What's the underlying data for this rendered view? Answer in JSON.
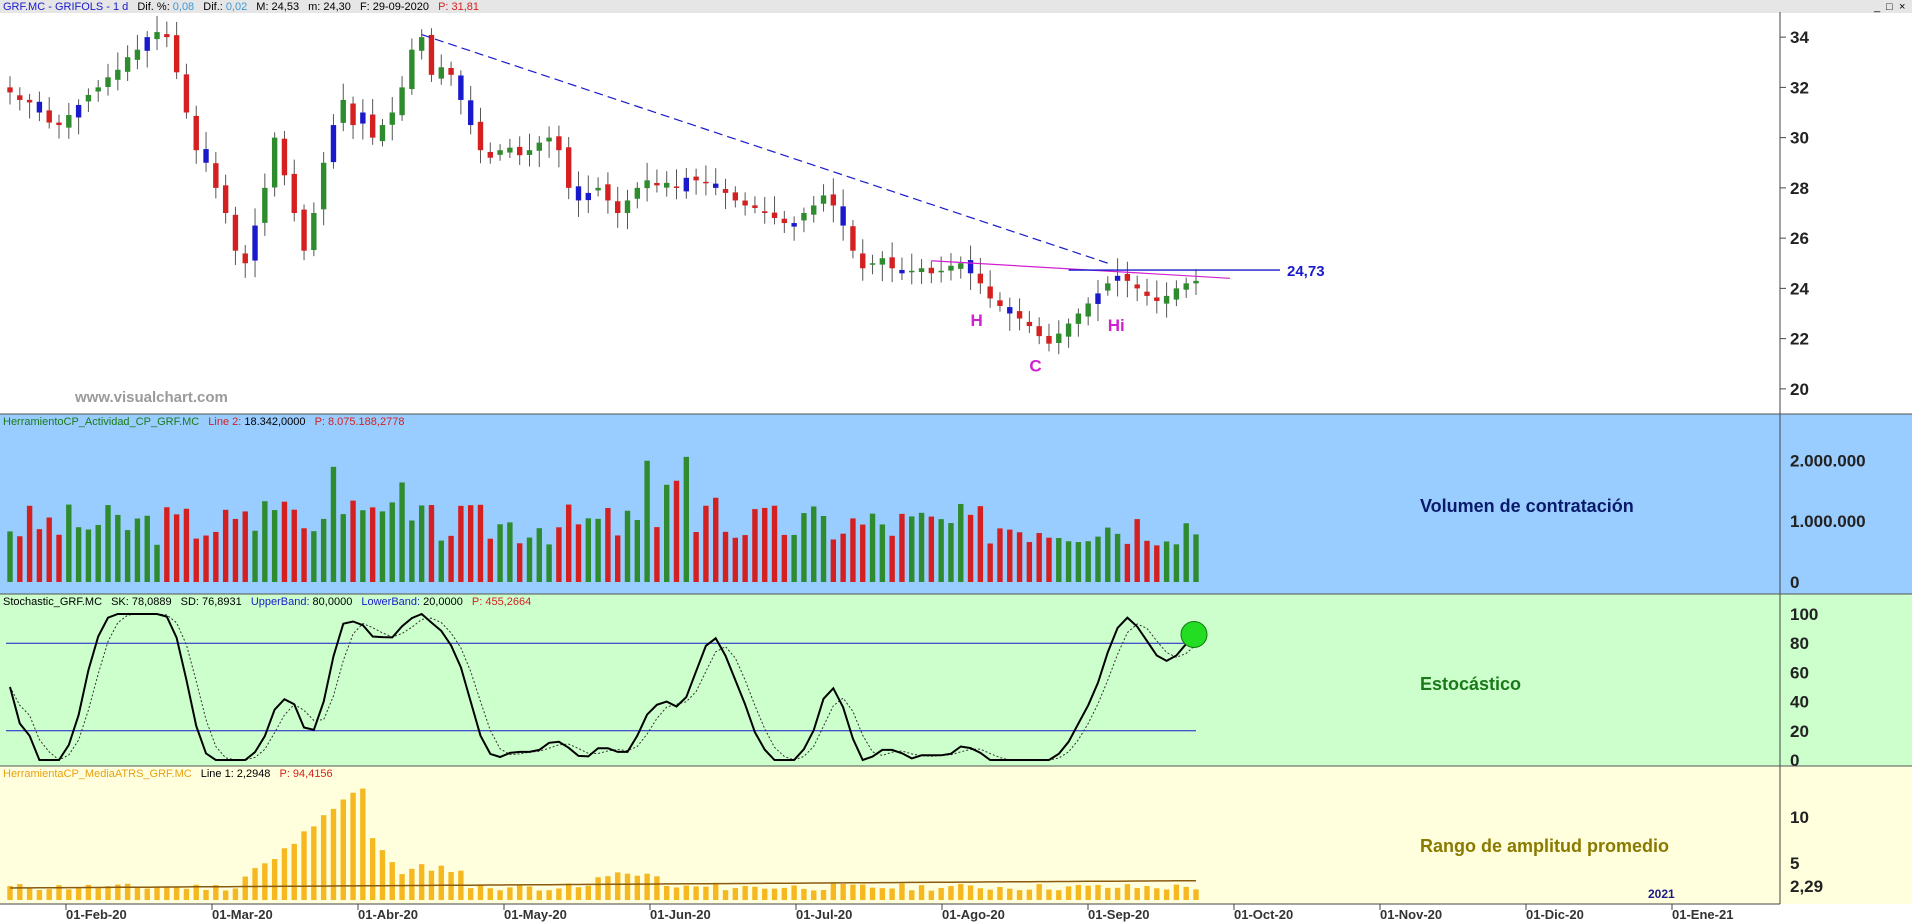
{
  "window": {
    "close_glyphs": [
      "_",
      "□",
      "×"
    ]
  },
  "header": {
    "title": "GRF.MC - GRIFOLS -  1 d",
    "dif_pct_label": "Dif. %:",
    "dif_pct": "0,08",
    "dif_label": "Dif.:",
    "dif": "0,02",
    "m_label": "M:",
    "m": "24,53",
    "mm_label": "m:",
    "mm": "24,30",
    "date_label": "F:",
    "date": "29-09-2020",
    "p_label": "P:",
    "p": "31,81"
  },
  "watermark": "www.visualchart.com",
  "colors": {
    "up": "#2e8b2e",
    "down": "#d42020",
    "blue": "#1a1acc",
    "magenta": "#d020d0",
    "vol_bg": "#99ccff",
    "sto_bg": "#ccffcc",
    "atr_bg": "#ffffdd",
    "atr_bar": "#f5b820"
  },
  "volume_panel": {
    "header": "HerramientoCP_Actividad_CP_GRF.MC",
    "line2_label": "Line 2:",
    "line2": "18.342,0000",
    "p_label": "P:",
    "p": "8.075.188,2778",
    "title": "Volumen de contratación"
  },
  "stochastic_panel": {
    "header": "Stochastic_GRF.MC",
    "sk_label": "SK:",
    "sk": "78,0889",
    "sd_label": "SD:",
    "sd": "76,8931",
    "ub_label": "UpperBand:",
    "ub": "80,0000",
    "lb_label": "LowerBand:",
    "lb": "20,0000",
    "p_label": "P:",
    "p": "455,2664",
    "title": "Estocástico"
  },
  "atr_panel": {
    "header": "HerramientaCP_MediaATRS_GRF.MC",
    "line1_label": "Line 1:",
    "line1": "2,2948",
    "p_label": "P:",
    "p": "94,4156",
    "title": "Rango de amplitud promedio",
    "last_value": "2,29",
    "year_marker": "2021"
  },
  "chart_data": [
    {
      "type": "candlestick",
      "series": [
        {
          "close": [
            31.8,
            31.5,
            31.4,
            31.0,
            30.6,
            30.5,
            30.9,
            31.3,
            31.7,
            32.0,
            32.4,
            32.7,
            33.2,
            33.5,
            34.0,
            34.2,
            34.0,
            32.6,
            31.0,
            29.5,
            29.0,
            28.0,
            27.0,
            25.5,
            25.0,
            26.5,
            28.0,
            30.0,
            28.5,
            27.0,
            25.5,
            27.0,
            29.0,
            30.5,
            31.5,
            30.5,
            31.0,
            30.0,
            30.5,
            31.0,
            32.0,
            33.5,
            34.0,
            32.5,
            32.8,
            32.5,
            31.5,
            30.5,
            29.5,
            29.2,
            29.5,
            29.6,
            29.3,
            29.5,
            29.8,
            30.0,
            29.5,
            28.0,
            27.5,
            27.8,
            28.0,
            27.5,
            27.0,
            27.5,
            28.0,
            28.3,
            28.1,
            28.2,
            28.0,
            28.4,
            28.3,
            28.2,
            28.0,
            27.8,
            27.5,
            27.3,
            27.2,
            27.0,
            26.8,
            26.6,
            26.6,
            27.0,
            27.3,
            27.7,
            27.3,
            26.5,
            25.5,
            24.8,
            25.0,
            25.2,
            24.8,
            24.6,
            24.7,
            24.8,
            24.6,
            24.7,
            24.9,
            25.0,
            24.6,
            24.2,
            23.6,
            23.3,
            23.0,
            22.8,
            22.5,
            22.1,
            21.8,
            22.2,
            22.6,
            23.0,
            23.4,
            23.8,
            24.2,
            24.5,
            24.3,
            24.0,
            23.7,
            23.5,
            23.7,
            24.0,
            24.2,
            24.3
          ]
        }
      ],
      "high_ref": 34.2,
      "low_ref": 21.8,
      "ylim": [
        19,
        35
      ],
      "yticks": [
        20,
        22,
        24,
        26,
        28,
        30,
        32,
        34
      ],
      "resistance": 24.73,
      "resistance_label": "24,73",
      "pattern_labels": [
        "H",
        "C",
        "Hi"
      ]
    },
    {
      "type": "bar",
      "name": "volume",
      "yticks": [
        0,
        1000000,
        2000000
      ],
      "ytick_labels": [
        "0",
        "1.000.000",
        "2.000.000"
      ],
      "ylim": [
        0,
        2500000
      ]
    },
    {
      "type": "line",
      "name": "stochastic",
      "ylim": [
        0,
        100
      ],
      "yticks": [
        0,
        20,
        40,
        60,
        80,
        100
      ],
      "bands": [
        20,
        80
      ],
      "sk_last": 78.0889,
      "sd_last": 76.8931
    },
    {
      "type": "bar",
      "name": "atr",
      "ylim": [
        1,
        14
      ],
      "yticks": [
        5,
        10
      ],
      "last": 2.2948
    }
  ],
  "x_axis": {
    "labels": [
      "01-Feb-20",
      "01-Mar-20",
      "01-Abr-20",
      "01-May-20",
      "01-Jun-20",
      "01-Jul-20",
      "01-Ago-20",
      "01-Sep-20",
      "01-Oct-20",
      "01-Nov-20",
      "01-Dic-20",
      "01-Ene-21"
    ]
  }
}
